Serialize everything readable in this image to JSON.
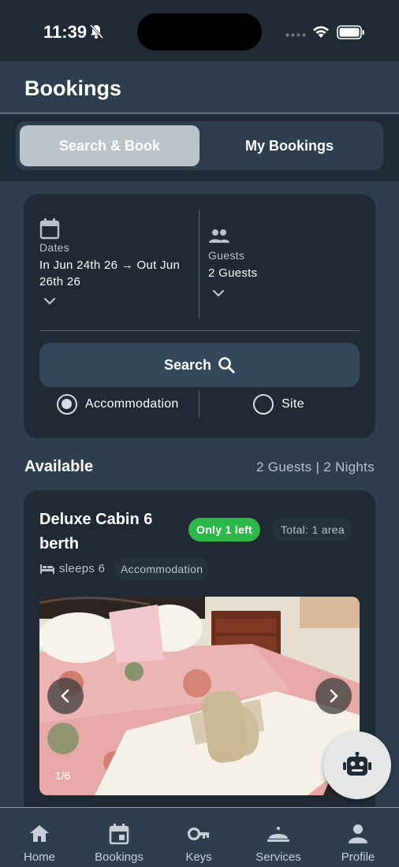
{
  "status_bar": {
    "time": "11:39"
  },
  "header": {
    "title": "Bookings"
  },
  "tabs": [
    {
      "label": "Search & Book",
      "active": true
    },
    {
      "label": "My Bookings",
      "active": false
    }
  ],
  "search": {
    "dates_label": "Dates",
    "dates_value": "In Jun 24th 26 → Out Jun 26th 26",
    "guests_label": "Guests",
    "guests_value": "2 Guests",
    "search_button": "Search",
    "options": [
      {
        "label": "Accommodation",
        "selected": true
      },
      {
        "label": "Site",
        "selected": false
      }
    ]
  },
  "available": {
    "title": "Available",
    "summary": "2 Guests | 2 Nights"
  },
  "room": {
    "name": "Deluxe Cabin 6 berth",
    "availability_badge": "Only 1 left",
    "total_badge": "Total: 1 area",
    "sleeps": "sleeps 6",
    "type": "Accommodation",
    "image_counter": "1/6"
  },
  "bottom_nav": [
    {
      "label": "Home",
      "icon": "home-icon"
    },
    {
      "label": "Bookings",
      "icon": "calendar-icon"
    },
    {
      "label": "Keys",
      "icon": "key-icon"
    },
    {
      "label": "Services",
      "icon": "bell-service-icon"
    },
    {
      "label": "Profile",
      "icon": "person-icon"
    }
  ],
  "colors": {
    "background": "#2e3e4e",
    "card": "#1f2a35",
    "success": "#2fb84a",
    "tab_active": "#bcc3ca"
  }
}
